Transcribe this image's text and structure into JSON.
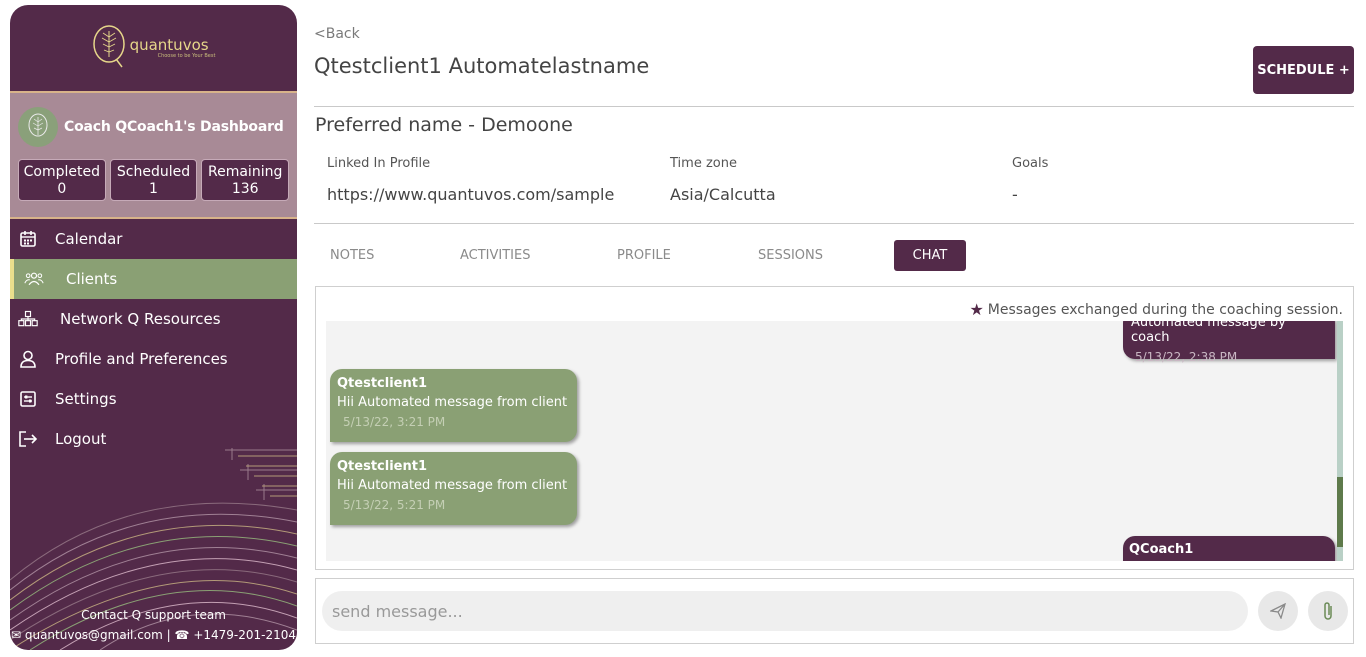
{
  "sidebar": {
    "logo_text": "quantuvos",
    "logo_tagline": "Choose to be Your Best",
    "dashboard_title": "Coach QCoach1's Dashboard",
    "stats": [
      {
        "label": "Completed",
        "value": "0"
      },
      {
        "label": "Scheduled",
        "value": "1"
      },
      {
        "label": "Remaining",
        "value": "136"
      }
    ],
    "nav": [
      {
        "label": "Calendar",
        "icon": "calendar-icon"
      },
      {
        "label": "Clients",
        "icon": "clients-icon",
        "active": true
      },
      {
        "label": "Network Q Resources",
        "icon": "network-icon"
      },
      {
        "label": "Profile and Preferences",
        "icon": "profile-icon"
      },
      {
        "label": "Settings",
        "icon": "settings-icon"
      },
      {
        "label": "Logout",
        "icon": "logout-icon"
      }
    ],
    "contact_title": "Contact Q support team",
    "contact_email": "quantuvos@gmail.com",
    "contact_phone": "+1479-201-2104"
  },
  "header": {
    "back": "<Back",
    "client_name": "Qtestclient1 Automatelastname",
    "schedule_button": "SCHEDULE +",
    "preferred_name": "Preferred name  - Demoone"
  },
  "info": {
    "linkedin_label": "Linked In Profile",
    "linkedin_value": "https://www.quantuvos.com/sample",
    "timezone_label": "Time zone",
    "timezone_value": "Asia/Calcutta",
    "goals_label": "Goals",
    "goals_value": "-"
  },
  "tabs": [
    "NOTES",
    "ACTIVITIES",
    "PROFILE",
    "SESSIONS",
    "CHAT"
  ],
  "chat": {
    "note": "Messages exchanged during the coaching session.",
    "messages": [
      {
        "direction": "out",
        "text": "Automated message by coach",
        "time": "5/13/22, 2:38 PM"
      },
      {
        "direction": "in",
        "sender": "Qtestclient1",
        "text": "Hii Automated message from client",
        "time": "5/13/22, 3:21 PM"
      },
      {
        "direction": "in",
        "sender": "Qtestclient1",
        "text": "Hii Automated message from client",
        "time": "5/13/22, 5:21 PM"
      },
      {
        "direction": "out",
        "sender": "QCoach1"
      }
    ],
    "input_placeholder": "send message..."
  },
  "colors": {
    "brand_purple": "#532a49",
    "accent_green": "#8aa074",
    "accent_gold": "#e6d68a"
  }
}
